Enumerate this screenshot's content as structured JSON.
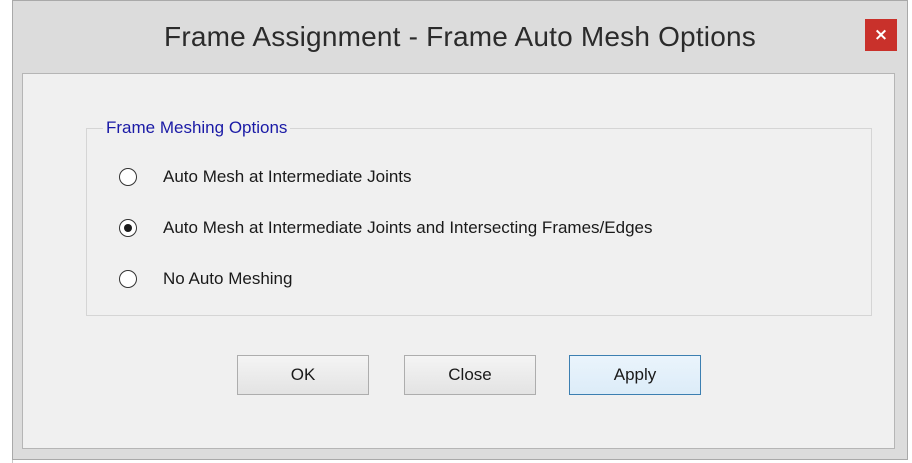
{
  "dialog": {
    "title": "Frame Assignment - Frame Auto Mesh Options",
    "close_glyph": "×"
  },
  "group": {
    "label": "Frame Meshing Options",
    "options": [
      {
        "label": "Auto Mesh at Intermediate Joints",
        "selected": false
      },
      {
        "label": "Auto Mesh at Intermediate Joints and Intersecting Frames/Edges",
        "selected": true
      },
      {
        "label": "No Auto Meshing",
        "selected": false
      }
    ]
  },
  "buttons": {
    "ok": "OK",
    "close": "Close",
    "apply": "Apply"
  },
  "colors": {
    "close_button": "#c9312b",
    "group_label": "#1a1aa6",
    "focused_button_border": "#3c7fb1"
  },
  "icons": {
    "close": "close-icon",
    "radio": "radio-button-icon"
  }
}
